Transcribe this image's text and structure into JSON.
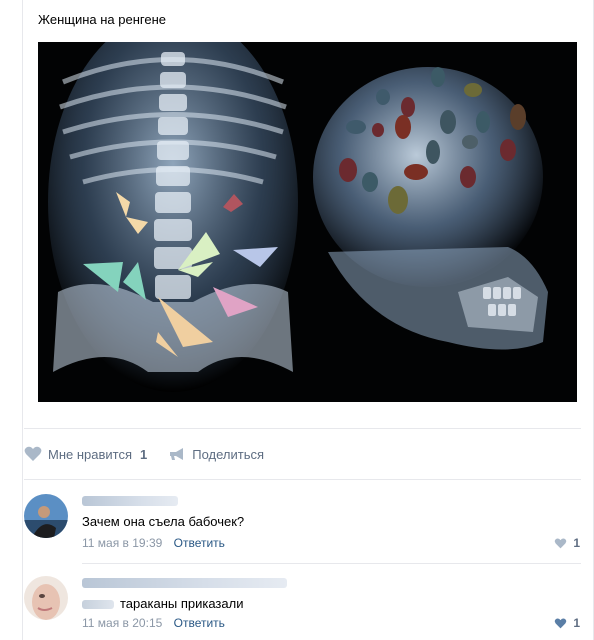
{
  "post": {
    "text": "Женщина на ренгене",
    "image_alt": "x-ray-collage"
  },
  "actions": {
    "like_label": "Мне нравится",
    "like_count": "1",
    "share_label": "Поделиться"
  },
  "comments": [
    {
      "text": "Зачем она съела бабочек?",
      "date": "11 мая в 19:39",
      "reply": "Ответить",
      "likes": "1"
    },
    {
      "text": "тараканы приказали",
      "date": "11 мая в 20:15",
      "reply": "Ответить",
      "likes": "1"
    }
  ],
  "colors": {
    "accent": "#2a5885",
    "muted": "#5e6d82",
    "meta": "#8b97a6",
    "divider": "#e7e8ec"
  },
  "icons": {
    "like": "heart-icon",
    "share": "megaphone-icon"
  }
}
